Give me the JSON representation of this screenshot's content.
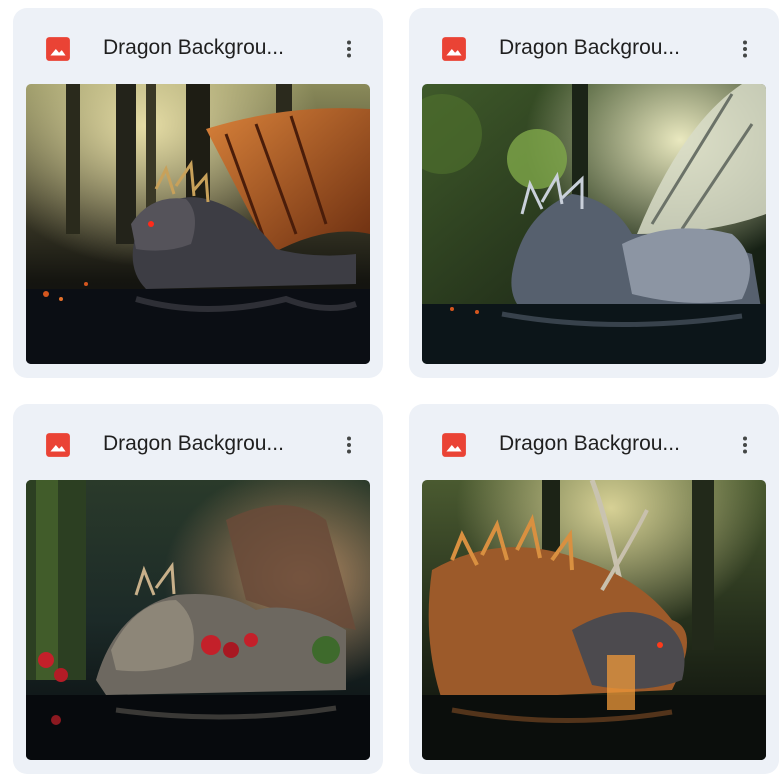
{
  "files": [
    {
      "name": "Dragon Backgrou...",
      "icon": "image-file-icon",
      "menu_icon": "more-vertical-icon"
    },
    {
      "name": "Dragon Backgrou...",
      "icon": "image-file-icon",
      "menu_icon": "more-vertical-icon"
    },
    {
      "name": "Dragon Backgrou...",
      "icon": "image-file-icon",
      "menu_icon": "more-vertical-icon"
    },
    {
      "name": "Dragon Backgrou...",
      "icon": "image-file-icon",
      "menu_icon": "more-vertical-icon"
    }
  ],
  "colors": {
    "card_background": "#edf1f7",
    "image_icon": "#ea4335",
    "title_text": "#1f1f1f",
    "menu_icon": "#444746"
  }
}
